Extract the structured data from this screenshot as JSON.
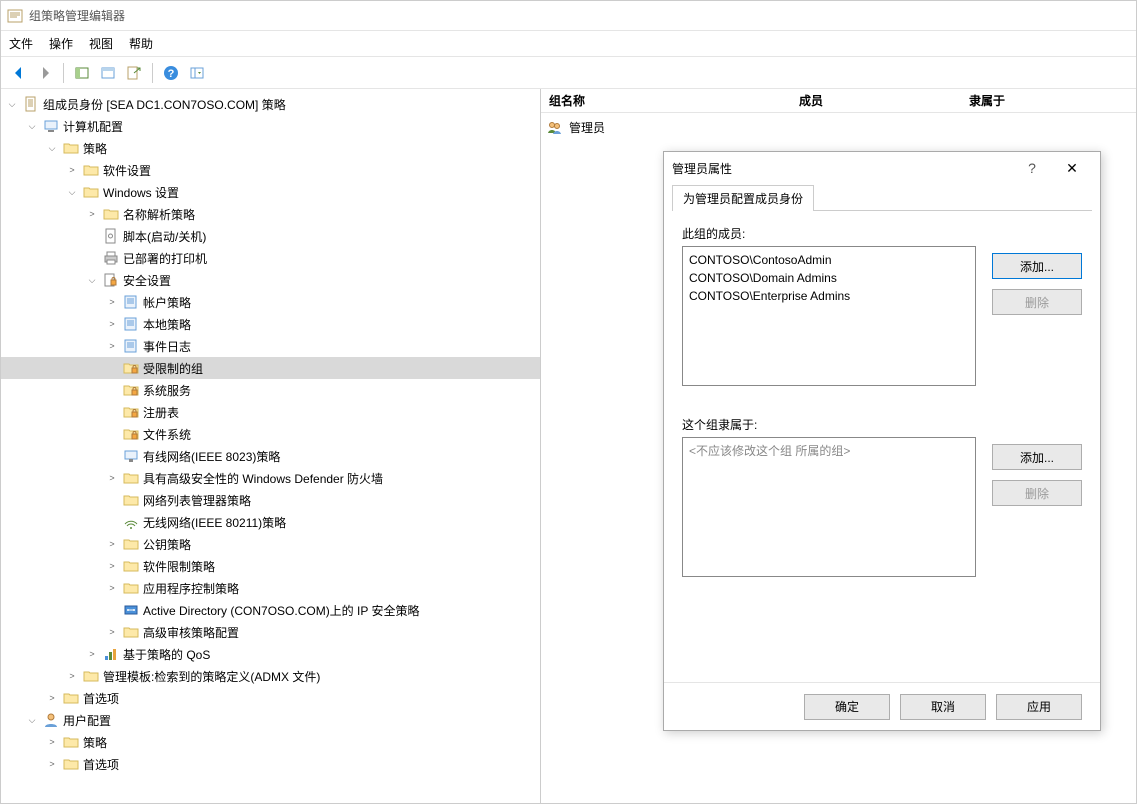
{
  "window": {
    "title": "组策略管理编辑器"
  },
  "menubar": {
    "file": "文件",
    "action": "操作",
    "view": "视图",
    "help": "帮助"
  },
  "tree": {
    "root": "组成员身份 [SEA DC1.CON7OSO.COM] 策略",
    "computer_config": "计算机配置",
    "policy": "策略",
    "software_settings": "软件设置",
    "windows_settings": "Windows 设置",
    "name_resolution": "名称解析策略",
    "scripts": "脚本(启动/关机)",
    "printers": "已部署的打印机",
    "security_settings": "安全设置",
    "account_policy": "帐户策略",
    "local_policy": "本地策略",
    "event_log": "事件日志",
    "restricted_groups": "受限制的组",
    "system_services": "系统服务",
    "registry": "注册表",
    "file_system": "文件系统",
    "wired_network": "有线网络(IEEE 8023)策略",
    "defender": "具有高级安全性的 Windows Defender 防火墙",
    "network_list": "网络列表管理器策略",
    "wireless_network": "无线网络(IEEE 80211)策略",
    "public_key": "公钥策略",
    "software_restriction": "软件限制策略",
    "app_control": "应用程序控制策略",
    "ipsec": "Active Directory (CON7OSO.COM)上的 IP 安全策略",
    "advanced_audit": "高级审核策略配置",
    "qos": "基于策略的 QoS",
    "admin_templates": "管理模板:检索到的策略定义(ADMX 文件)",
    "preferences": "首选项",
    "user_config": "用户配置",
    "user_policy": "策略",
    "user_preferences": "首选项"
  },
  "list": {
    "col_name": "组名称",
    "col_members": "成员",
    "col_memberof": "隶属于",
    "rows": [
      {
        "name": "管理员"
      }
    ]
  },
  "dialog": {
    "title": "管理员属性",
    "tab": "为管理员配置成员身份",
    "members_label": "此组的成员:",
    "members": [
      "CONTOSO\\ContosoAdmin",
      "CONTOSO\\Domain Admins",
      "CONTOSO\\Enterprise Admins"
    ],
    "memberof_label": "这个组隶属于:",
    "memberof_placeholder": "<不应该修改这个组 所属的组>",
    "add": "添加...",
    "remove": "删除",
    "ok": "确定",
    "cancel": "取消",
    "apply": "应用"
  }
}
